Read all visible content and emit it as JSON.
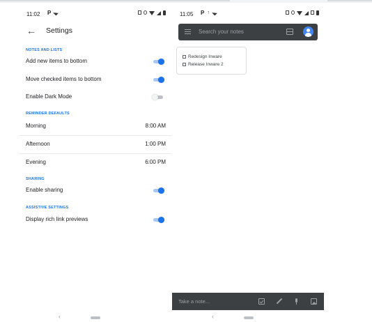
{
  "left_phone": {
    "status": {
      "time": "11:02"
    },
    "header": {
      "title": "Settings"
    },
    "sections": {
      "notes_lists": "NOTES AND LISTS",
      "reminder_defaults": "REMINDER DEFAULTS",
      "sharing": "SHARING",
      "assistive": "ASSISTIVE SETTINGS"
    },
    "toggles": {
      "add_new_bottom": {
        "label": "Add new items to bottom",
        "on": true
      },
      "move_checked_bottom": {
        "label": "Move checked items to bottom",
        "on": true
      },
      "dark_mode": {
        "label": "Enable Dark Mode",
        "on": false
      },
      "enable_sharing": {
        "label": "Enable sharing",
        "on": true
      },
      "rich_link_previews": {
        "label": "Display rich link previews",
        "on": true
      }
    },
    "reminders": [
      {
        "label": "Morning",
        "time": "8:00 AM"
      },
      {
        "label": "Afternoon",
        "time": "1:00 PM"
      },
      {
        "label": "Evening",
        "time": "6:00 PM"
      }
    ]
  },
  "right_phone": {
    "status": {
      "time": "11:05"
    },
    "search": {
      "placeholder": "Search your notes"
    },
    "note": {
      "items": [
        {
          "text": "Redesign Inware",
          "checked": false
        },
        {
          "text": "Release Inware 2",
          "checked": false
        }
      ]
    },
    "bottom_bar": {
      "placeholder": "Take a note..."
    }
  },
  "colors": {
    "accent": "#1a73e8",
    "toggle_track_on": "#a8c7fa",
    "dark_bar": "#3c4043"
  },
  "icons": {
    "back": "arrow-left-icon",
    "menu": "hamburger-menu-icon",
    "layout": "list-view-icon",
    "account": "account-avatar-icon",
    "checkbox": "new-list-icon",
    "brush": "brush-icon",
    "mic": "mic-icon",
    "image": "image-icon"
  }
}
